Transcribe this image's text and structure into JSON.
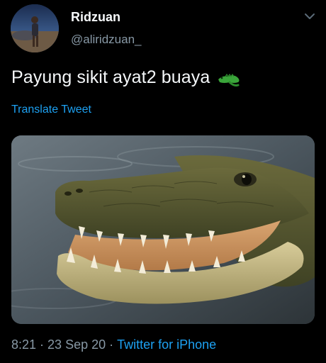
{
  "user": {
    "display_name": "Ridzuan",
    "handle": "@aliridzuan_"
  },
  "tweet": {
    "text": "Payung sikit ayat2 buaya",
    "emoji_icon": "crocodile-emoji",
    "translate_label": "Translate Tweet",
    "media_icon": "crocodile-photo"
  },
  "meta": {
    "time": "8:21",
    "separator_1": "·",
    "date": "23 Sep 20",
    "separator_2": "·",
    "source": "Twitter for iPhone"
  },
  "colors": {
    "background": "#000000",
    "primary_text": "#f5f8fa",
    "secondary_text": "#8899a6",
    "link": "#1da1f2"
  }
}
